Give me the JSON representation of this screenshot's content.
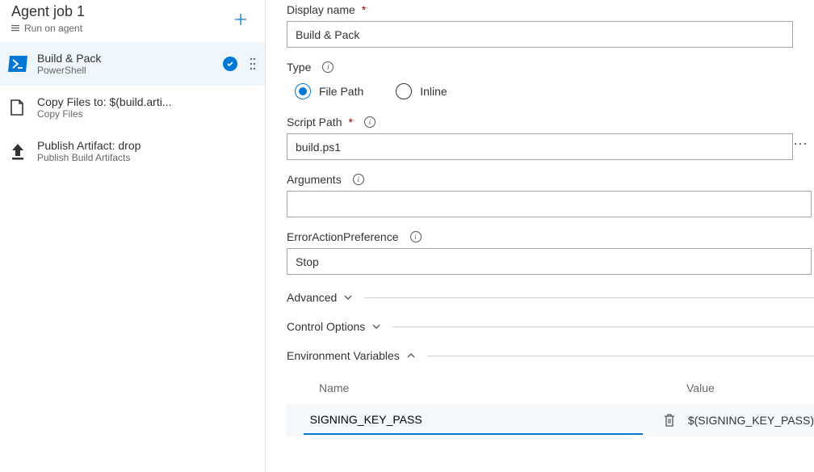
{
  "agent": {
    "title": "Agent job 1",
    "subtitle": "Run on agent"
  },
  "tasks": [
    {
      "title": "Build & Pack",
      "subtitle": "PowerShell",
      "selected": true,
      "status": true
    },
    {
      "title": "Copy Files to: $(build.arti...",
      "subtitle": "Copy Files",
      "selected": false,
      "status": false
    },
    {
      "title": "Publish Artifact: drop",
      "subtitle": "Publish Build Artifacts",
      "selected": false,
      "status": false
    }
  ],
  "form": {
    "displayName": {
      "label": "Display name",
      "value": "Build & Pack"
    },
    "type": {
      "label": "Type",
      "options": [
        "File Path",
        "Inline"
      ],
      "selected": "File Path"
    },
    "scriptPath": {
      "label": "Script Path",
      "value": "build.ps1"
    },
    "arguments": {
      "label": "Arguments",
      "value": ""
    },
    "errorActionPreference": {
      "label": "ErrorActionPreference",
      "value": "Stop"
    },
    "sections": {
      "advanced": "Advanced",
      "controlOptions": "Control Options",
      "envVars": "Environment Variables"
    },
    "env": {
      "cols": {
        "name": "Name",
        "value": "Value"
      },
      "rows": [
        {
          "name": "SIGNING_KEY_PASS",
          "value": "$(SIGNING_KEY_PASS)"
        }
      ]
    }
  }
}
